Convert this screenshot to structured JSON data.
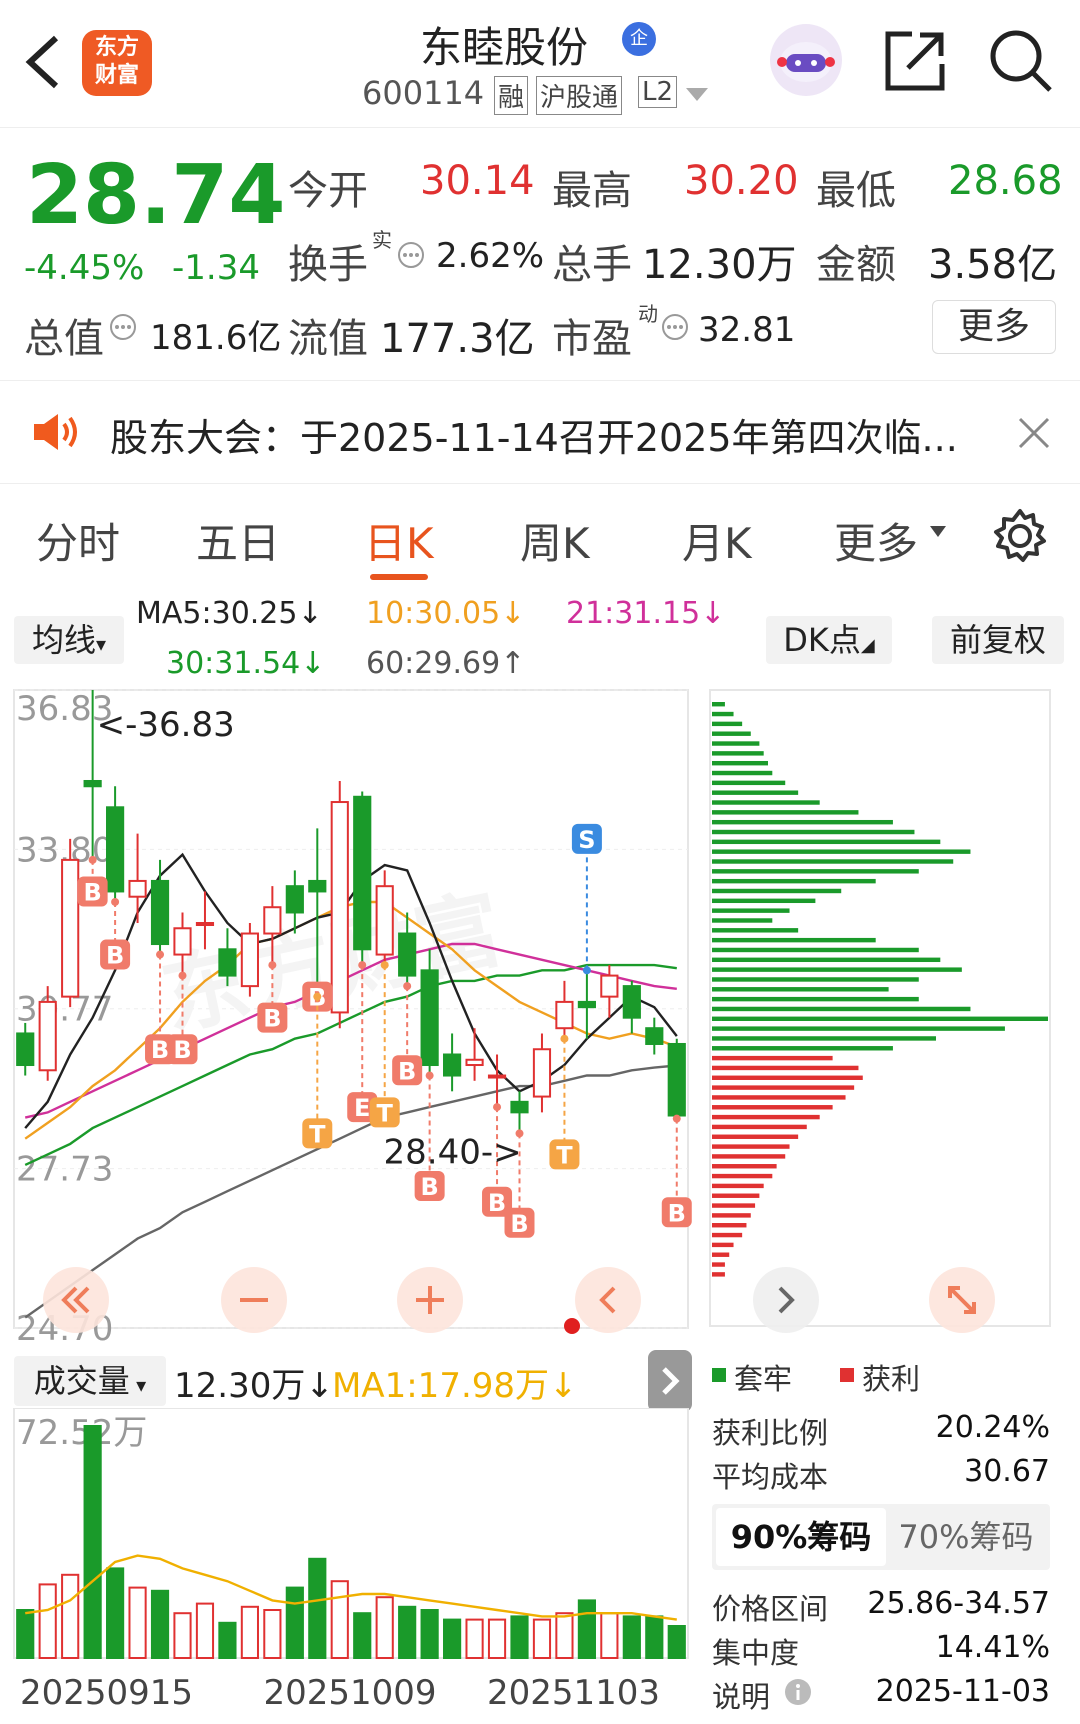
{
  "header": {
    "logo_text_1": "东方",
    "logo_text_2": "财富",
    "stock_name": "东睦股份",
    "badge": "企",
    "code": "600114",
    "tag_margin": "融",
    "tag_connect": "沪股通",
    "tag_level": "L2"
  },
  "quote": {
    "price": "28.74",
    "change_pct": "-4.45%",
    "change_amt": "-1.34",
    "open_label": "今开",
    "open": "30.14",
    "high_label": "最高",
    "high": "30.20",
    "low_label": "最低",
    "low": "28.68",
    "turnover_label": "换手",
    "turnover_sup": "实",
    "turnover": "2.62%",
    "volume_label": "总手",
    "volume": "12.30万",
    "amount_label": "金额",
    "amount": "3.58亿",
    "mktcap_label": "总值",
    "mktcap": "181.6亿",
    "float_label": "流值",
    "float": "177.3亿",
    "pe_label": "市盈",
    "pe_sup": "动",
    "pe": "32.81",
    "more": "更多"
  },
  "notice": {
    "text": "股东大会：于2025-11-14召开2025年第四次临..."
  },
  "tabs": {
    "items": [
      "分时",
      "五日",
      "日K",
      "周K",
      "月K",
      "更多"
    ],
    "active": "日K"
  },
  "kline": {
    "ma_button": "均线",
    "ma5": "MA5:30.25↓",
    "ma10": "10:30.05↓",
    "ma21": "21:31.15↓",
    "ma30": "30:31.54↓",
    "ma60": "60:29.69↑",
    "dk_button": "DK点",
    "adjust_button": "前复权",
    "y_ticks": [
      "36.83",
      "33.80",
      "30.77",
      "27.73",
      "24.70"
    ],
    "max_marker": "<-36.83",
    "min_marker": "28.40->",
    "colors": {
      "up": "#e03131",
      "down": "#1a9a2a",
      "ma5": "#222222",
      "ma10": "#f0a020",
      "ma21": "#d0309a",
      "ma30": "#1a9a2a",
      "ma60": "#666666"
    }
  },
  "chart_data": {
    "type": "candlestick",
    "y_range": [
      24.7,
      36.83
    ],
    "candles": [
      {
        "o": 30.3,
        "c": 29.7,
        "h": 30.5,
        "l": 29.5
      },
      {
        "o": 29.6,
        "c": 30.9,
        "h": 31.2,
        "l": 29.4
      },
      {
        "o": 31.0,
        "c": 33.6,
        "h": 34.0,
        "l": 30.8
      },
      {
        "o": 35.1,
        "c": 35.0,
        "h": 36.83,
        "l": 33.6
      },
      {
        "o": 34.6,
        "c": 33.0,
        "h": 35.0,
        "l": 32.8
      },
      {
        "o": 32.9,
        "c": 33.2,
        "h": 34.1,
        "l": 32.4
      },
      {
        "o": 33.2,
        "c": 32.0,
        "h": 33.6,
        "l": 31.8
      },
      {
        "o": 31.8,
        "c": 32.3,
        "h": 32.6,
        "l": 31.4
      },
      {
        "o": 32.4,
        "c": 32.4,
        "h": 33.0,
        "l": 31.9
      },
      {
        "o": 31.9,
        "c": 31.4,
        "h": 32.3,
        "l": 31.2
      },
      {
        "o": 31.2,
        "c": 32.2,
        "h": 32.4,
        "l": 31.0
      },
      {
        "o": 32.2,
        "c": 32.7,
        "h": 33.1,
        "l": 31.6
      },
      {
        "o": 33.1,
        "c": 32.6,
        "h": 33.4,
        "l": 32.2
      },
      {
        "o": 33.2,
        "c": 33.0,
        "h": 34.2,
        "l": 31.0
      },
      {
        "o": 30.7,
        "c": 34.7,
        "h": 35.1,
        "l": 30.4
      },
      {
        "o": 34.8,
        "c": 31.9,
        "h": 34.9,
        "l": 31.6
      },
      {
        "o": 31.8,
        "c": 33.1,
        "h": 33.4,
        "l": 31.6
      },
      {
        "o": 32.2,
        "c": 31.4,
        "h": 32.6,
        "l": 31.2
      },
      {
        "o": 31.5,
        "c": 29.7,
        "h": 31.9,
        "l": 29.5
      },
      {
        "o": 29.9,
        "c": 29.5,
        "h": 30.3,
        "l": 29.2
      },
      {
        "o": 29.7,
        "c": 29.8,
        "h": 30.4,
        "l": 29.4
      },
      {
        "o": 29.5,
        "c": 29.5,
        "h": 29.9,
        "l": 28.9
      },
      {
        "o": 29.0,
        "c": 28.8,
        "h": 29.2,
        "l": 28.4
      },
      {
        "o": 29.1,
        "c": 30.0,
        "h": 30.3,
        "l": 28.8
      },
      {
        "o": 30.4,
        "c": 30.9,
        "h": 31.3,
        "l": 30.2
      },
      {
        "o": 30.9,
        "c": 30.8,
        "h": 31.5,
        "l": 30.2
      },
      {
        "o": 31.0,
        "c": 31.4,
        "h": 31.6,
        "l": 30.6
      },
      {
        "o": 31.2,
        "c": 30.6,
        "h": 31.3,
        "l": 30.3
      },
      {
        "o": 30.4,
        "c": 30.1,
        "h": 30.6,
        "l": 29.9
      },
      {
        "o": 30.1,
        "c": 28.74,
        "h": 30.2,
        "l": 28.68
      }
    ],
    "ma_lines": {
      "MA5": [
        28.5,
        29.0,
        29.9,
        30.6,
        31.5,
        32.6,
        33.3,
        33.7,
        33.0,
        32.4,
        32.0,
        32.1,
        32.3,
        32.5,
        32.6,
        33.2,
        33.5,
        33.4,
        32.4,
        31.3,
        30.3,
        29.6,
        29.2,
        29.4,
        29.7,
        30.2,
        30.6,
        31.0,
        30.8,
        30.25
      ],
      "MA10": [
        28.3,
        28.6,
        28.9,
        29.3,
        29.6,
        30.0,
        30.4,
        30.9,
        31.3,
        31.6,
        32.0,
        32.1,
        32.3,
        32.5,
        32.7,
        32.8,
        32.8,
        32.5,
        32.2,
        31.9,
        31.5,
        31.2,
        30.9,
        30.7,
        30.5,
        30.3,
        30.2,
        30.3,
        30.2,
        30.05
      ],
      "MA21": [
        28.7,
        28.8,
        29.0,
        29.2,
        29.4,
        29.6,
        29.8,
        30.0,
        30.2,
        30.4,
        30.6,
        30.8,
        30.9,
        31.1,
        31.3,
        31.5,
        31.7,
        31.8,
        31.9,
        32.0,
        32.0,
        31.9,
        31.8,
        31.7,
        31.6,
        31.5,
        31.4,
        31.3,
        31.2,
        31.15
      ],
      "MA30": [
        27.8,
        28.0,
        28.2,
        28.5,
        28.7,
        28.9,
        29.1,
        29.3,
        29.5,
        29.7,
        29.9,
        30.0,
        30.2,
        30.3,
        30.5,
        30.7,
        30.9,
        31.0,
        31.2,
        31.3,
        31.3,
        31.4,
        31.4,
        31.5,
        31.5,
        31.6,
        31.6,
        31.6,
        31.6,
        31.54
      ],
      "MA60": [
        24.9,
        25.2,
        25.5,
        25.8,
        26.1,
        26.4,
        26.6,
        26.9,
        27.1,
        27.3,
        27.5,
        27.7,
        27.9,
        28.1,
        28.3,
        28.5,
        28.7,
        28.8,
        28.9,
        29.0,
        29.1,
        29.2,
        29.3,
        29.3,
        29.4,
        29.5,
        29.5,
        29.6,
        29.65,
        29.69
      ]
    },
    "dk_markers": [
      {
        "i": 3,
        "t": "B",
        "v": 33.0
      },
      {
        "i": 4,
        "t": "B",
        "v": 31.8
      },
      {
        "i": 6,
        "t": "B",
        "v": 30.0
      },
      {
        "i": 7,
        "t": "B",
        "v": 30.0
      },
      {
        "i": 11,
        "t": "B",
        "v": 30.6
      },
      {
        "i": 13,
        "t": "B",
        "v": 31.0
      },
      {
        "i": 13,
        "t": "T",
        "v": 28.4
      },
      {
        "i": 15,
        "t": "E",
        "v": 28.9
      },
      {
        "i": 16,
        "t": "T",
        "v": 28.8
      },
      {
        "i": 17,
        "t": "B",
        "v": 29.6
      },
      {
        "i": 18,
        "t": "B",
        "v": 27.4
      },
      {
        "i": 21,
        "t": "B",
        "v": 27.1
      },
      {
        "i": 22,
        "t": "B",
        "v": 26.7
      },
      {
        "i": 24,
        "t": "T",
        "v": 28.0
      },
      {
        "i": 25,
        "t": "S",
        "v": 34.0
      },
      {
        "i": 29,
        "t": "B",
        "v": 26.9
      }
    ],
    "volume": {
      "label": "成交量",
      "current": "12.30万↓",
      "ma1": "MA1:17.98万↓",
      "max_label": "72.52万",
      "values": [
        15,
        23,
        26,
        72.5,
        28,
        22,
        21,
        14,
        17,
        11,
        16,
        15,
        22,
        31,
        24,
        14,
        19,
        16,
        15,
        12,
        12,
        12,
        13,
        12,
        14,
        18,
        14,
        13,
        13,
        10
      ],
      "ma": [
        14,
        15,
        18,
        24,
        30,
        32,
        31,
        28,
        26,
        24,
        21,
        18,
        17,
        18,
        19,
        20,
        20,
        19,
        18,
        17,
        16,
        15,
        14,
        13,
        13,
        14,
        14,
        14,
        13,
        12
      ],
      "dates": [
        "20250915",
        "20251009",
        "20251103"
      ]
    },
    "chip_distribution": {
      "levels_green": [
        3,
        5,
        7,
        9,
        11,
        12,
        13,
        14,
        17,
        20,
        25,
        34,
        42,
        47,
        53,
        60,
        56,
        48,
        38,
        30,
        24,
        18,
        14,
        20,
        38,
        48,
        53,
        58,
        48,
        41,
        48,
        60,
        78,
        68,
        52,
        42
      ],
      "levels_red": [
        28,
        34,
        35,
        33,
        31,
        28,
        25,
        22,
        20,
        18,
        17,
        15,
        14,
        12,
        11,
        10,
        9,
        8,
        7,
        5,
        4,
        3,
        3
      ]
    }
  },
  "chip_panel": {
    "legend_trapped": "套牢",
    "legend_profit": "获利",
    "profit_ratio_label": "获利比例",
    "profit_ratio": "20.24%",
    "avg_cost_label": "平均成本",
    "avg_cost": "30.67",
    "tab_90": "90%筹码",
    "tab_70": "70%筹码",
    "price_range_label": "价格区间",
    "price_range": "25.86-34.57",
    "concentration_label": "集中度",
    "concentration": "14.41%",
    "note_label": "说明",
    "note_date": "2025-11-03"
  }
}
